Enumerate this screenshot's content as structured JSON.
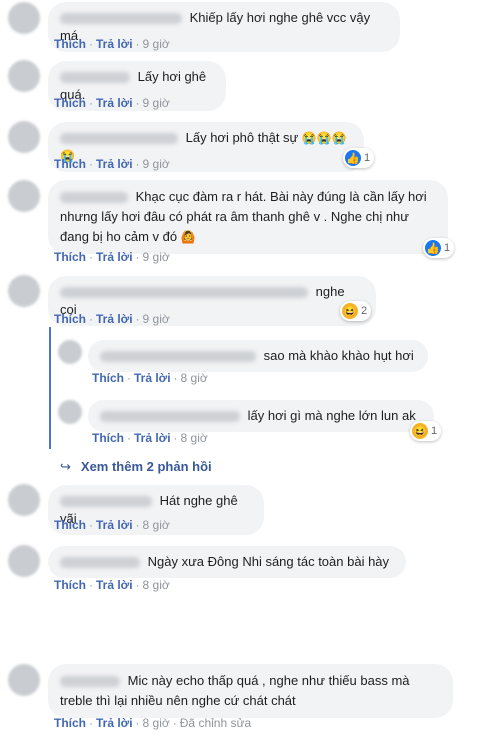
{
  "labels": {
    "like": "Thích",
    "reply": "Trả lời",
    "edited": "Đã chỉnh sửa"
  },
  "comments": [
    {
      "text": "Khiếp lấy hơi nghe ghê vcc vậy má",
      "time": "9 giờ"
    },
    {
      "text": "Lấy hơi ghê quá.",
      "time": "9 giờ"
    },
    {
      "text": "Lấy hơi phô thật sự",
      "emoji": "😭😭😭😭",
      "time": "9 giờ",
      "reactions": {
        "type": "like-icon",
        "count": "1"
      }
    },
    {
      "text": "Khạc cục đàm ra r hát. Bài này đúng là cần lấy hơi nhưng lấy hơi đâu có phát ra âm thanh ghê v . Nghe chị như đang bị ho cảm v đó",
      "emoji": "🙆",
      "time": "9 giờ",
      "reactions": {
        "type": "like-icon",
        "count": "1"
      }
    },
    {
      "text": "nghe coi",
      "time": "9 giờ",
      "reactions": {
        "type": "haha-icon",
        "count": "2"
      }
    },
    {
      "text": "Hát nghe ghê vãi",
      "time": "8 giờ"
    },
    {
      "text": "Ngày xưa Đông Nhi sáng tác toàn bài hày",
      "time": "8 giờ"
    },
    {
      "text": "Mic này echo thấp quá , nghe như thiếu bass mà treble thì lại nhiều nên nghe cứ chát chát",
      "time": "8 giờ",
      "edited": true
    }
  ],
  "replies": [
    {
      "text": "sao mà khào khào hụt hơi",
      "time": "8 giờ"
    },
    {
      "text": "lấy hơi gì mà nghe lớn lun ak",
      "time": "8 giờ",
      "reactions": {
        "type": "haha-icon",
        "count": "1"
      }
    }
  ],
  "see_more": "Xem thêm 2 phản hồi",
  "colors": {
    "link": "#4267b2",
    "bubble": "#f2f3f5",
    "thread": "#4a76d3"
  }
}
